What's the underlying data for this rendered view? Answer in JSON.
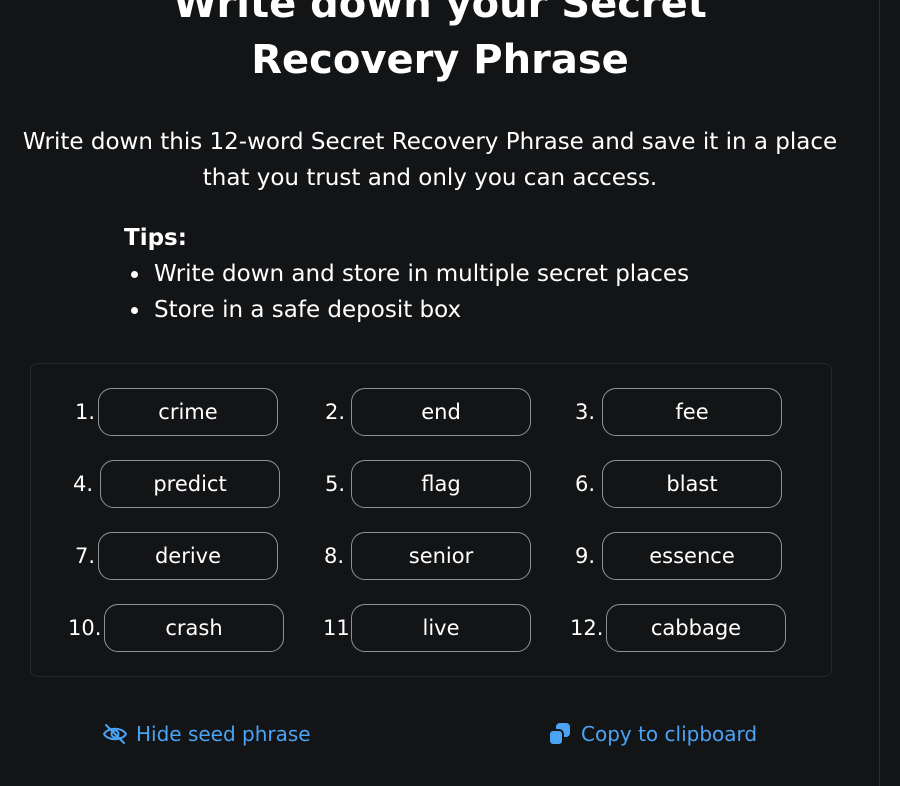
{
  "header": {
    "title_line1": "Write down your Secret",
    "title_line2": "Recovery Phrase"
  },
  "description": "Write down this 12-word Secret Recovery Phrase and save it in a place that you trust and only you can access.",
  "tips": {
    "title": "Tips:",
    "items": [
      "Write down and store in multiple secret places",
      "Store in a safe deposit box"
    ]
  },
  "phrase": {
    "words": [
      {
        "index": "1.",
        "word": "crime"
      },
      {
        "index": "2.",
        "word": "end"
      },
      {
        "index": "3.",
        "word": "fee"
      },
      {
        "index": "4.",
        "word": "predict"
      },
      {
        "index": "5.",
        "word": "flag"
      },
      {
        "index": "6.",
        "word": "blast"
      },
      {
        "index": "7.",
        "word": "derive"
      },
      {
        "index": "8.",
        "word": "senior"
      },
      {
        "index": "9.",
        "word": "essence"
      },
      {
        "index": "10.",
        "word": "crash"
      },
      {
        "index": "11.",
        "word": "live"
      },
      {
        "index": "12.",
        "word": "cabbage"
      }
    ]
  },
  "actions": {
    "hide_label": "Hide seed phrase",
    "hide_icon": "eye-slash-icon",
    "copy_label": "Copy to clipboard",
    "copy_icon": "copy-icon"
  },
  "colors": {
    "background": "#131416",
    "text": "#ffffff",
    "accent": "#4aa3f4",
    "chip_border": "#8e9196"
  }
}
